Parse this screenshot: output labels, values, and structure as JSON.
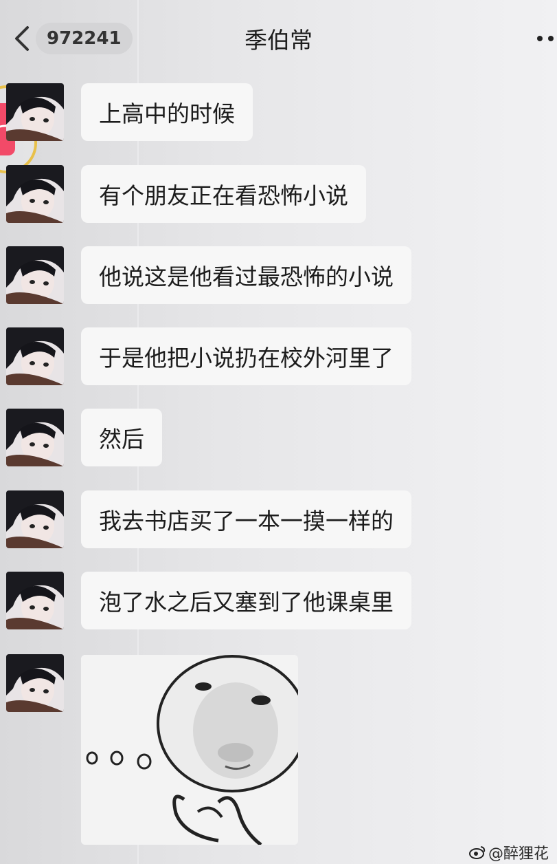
{
  "header": {
    "unread_count": "972241",
    "title": "季伯常",
    "back_icon": "chevron-left-icon",
    "more_icon": "more-dots-icon"
  },
  "messages": [
    {
      "text": "上高中的时候"
    },
    {
      "text": "有个朋友正在看恐怖小说"
    },
    {
      "text": "他说这是他看过最恐怖的小说"
    },
    {
      "text": "于是他把小说扔在校外河里了"
    },
    {
      "text": "然后"
    },
    {
      "text": "我去书店买了一本一摸一样的"
    },
    {
      "text": "泡了水之后又塞到了他课桌里"
    }
  ],
  "sticker": {
    "description_icon": "meme-face-sticker"
  },
  "watermark": {
    "text": "@醉狸花",
    "icon": "weibo-icon"
  },
  "colors": {
    "bubble_bg": "#f7f7f7",
    "float_ring": "#e8c04a",
    "float_fill": "#f24a68"
  }
}
